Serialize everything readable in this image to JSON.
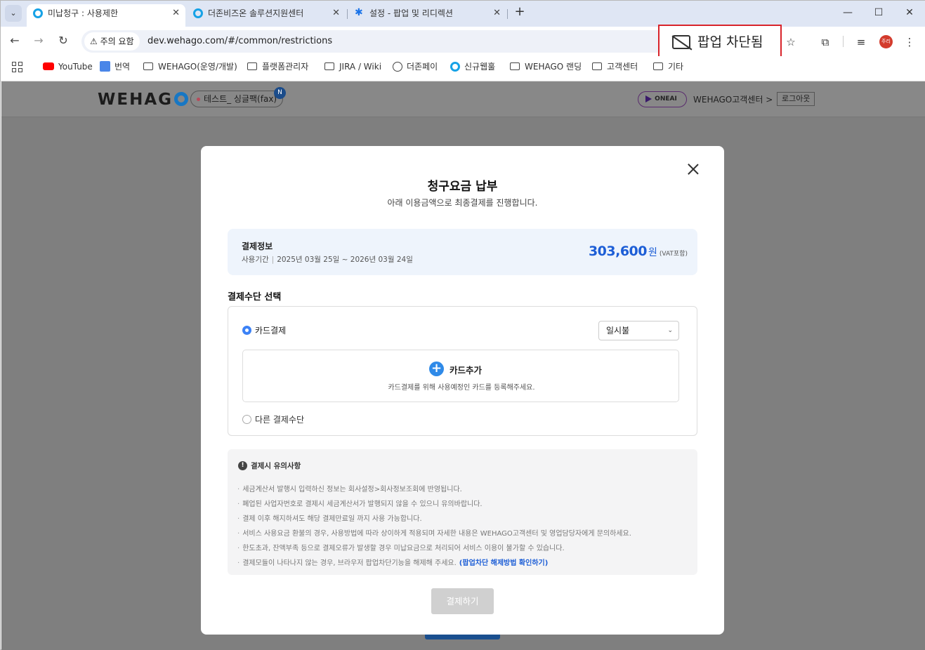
{
  "browser": {
    "tabs": [
      {
        "title": "미납청구 : 사용제한",
        "active": true
      },
      {
        "title": "더존비즈온 솔루션지원센터",
        "active": false
      },
      {
        "title": "설정 - 팝업 및 리디렉션",
        "active": false
      }
    ],
    "security_chip": "주의 요함",
    "url": "dev.wehago.com/#/common/restrictions",
    "popup_blocked": "팝업 차단됨",
    "profile_label": "주리",
    "bookmarks": [
      {
        "label": "YouTube",
        "icon": "youtube-icon"
      },
      {
        "label": "번역",
        "icon": "translate-icon"
      },
      {
        "label": "WEHAGO(운영/개발)",
        "icon": "folder-icon"
      },
      {
        "label": "플랫폼관리자",
        "icon": "folder-icon"
      },
      {
        "label": "JIRA / Wiki",
        "icon": "folder-icon"
      },
      {
        "label": "더존페이",
        "icon": "globe-icon"
      },
      {
        "label": "신규웹훌",
        "icon": "ring-icon"
      },
      {
        "label": "WEHAGO 랜딩",
        "icon": "folder-icon"
      },
      {
        "label": "고객센터",
        "icon": "folder-icon"
      },
      {
        "label": "기타",
        "icon": "folder-icon"
      }
    ]
  },
  "site": {
    "logo": "WEHAG",
    "company": "테스트_ 싱글팩(fax)",
    "badge": "N",
    "oneai": "ONEAI",
    "help": "WEHAGO고객센터 >",
    "logout": "로그아웃"
  },
  "modal": {
    "title": "청구요금 납부",
    "subtitle": "아래 이용금액으로 최종결제를 진행합니다.",
    "pay_info_title": "결제정보",
    "period_label": "사용기간",
    "period_value": "2025년 03월 25일 ~ 2026년 03월 24일",
    "amount": "303,600",
    "currency": "원",
    "vat": "(VAT포함)",
    "method_label": "결제수단 선택",
    "card_option": "카드결제",
    "installment": "일시불",
    "add_card": "카드추가",
    "add_card_desc": "카드결제를 위해 사용예정인 카드를 등록해주세요.",
    "other_option": "다른 결제수단",
    "notice_title": "결제시 유의사항",
    "notices": [
      "세금계산서 발행시 입력하신 정보는 회사설정>회사정보조회에 반영됩니다.",
      "폐업된 사업자번호로 결제시 세금계산서가 발행되지 않을 수 있으니 유의바랍니다.",
      "결제 이후 해지하셔도 해당 결제만료일 까지 사용 가능합니다.",
      "서비스 사용요금 환불의 경우, 사용방법에 따라 상이하게 적용되며 자세한 내용은 WEHAGO고객센터 및 영업담당자에게 문의하세요.",
      "한도초과, 잔액부족 등으로 결제오류가 발생할 경우 미납요금으로 처리되어 서비스 이용이 불가할 수 있습니다.",
      "결제모듈이 나타나지 않는 경우, 브라우저 팝업차단기능을 해제해 주세요."
    ],
    "notice_link": "(팝업차단 해제방법 확인하기)",
    "pay_button": "결제하기"
  }
}
